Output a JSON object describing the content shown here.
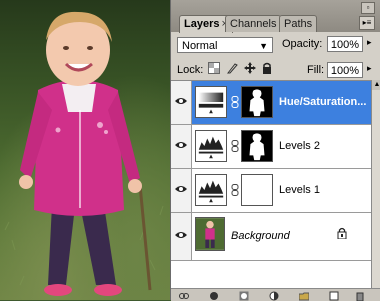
{
  "tabs": [
    {
      "label": "Layers",
      "close": "×"
    },
    {
      "label": "Channels"
    },
    {
      "label": "Paths"
    }
  ],
  "panel_menu_icon": "▸≡",
  "blend_mode": "Normal",
  "opacity": {
    "label": "Opacity:",
    "value": "100%"
  },
  "lock": {
    "label": "Lock:"
  },
  "fill": {
    "label": "Fill:",
    "value": "100%"
  },
  "layers": [
    {
      "name": "Hue/Saturation...",
      "selected": true
    },
    {
      "name": "Levels 2"
    },
    {
      "name": "Levels 1"
    },
    {
      "name": "Background",
      "locked": true
    }
  ],
  "icons": [
    "eye-icon",
    "link-icon",
    "lock-icon",
    "move-icon",
    "brush-icon",
    "checker-icon"
  ],
  "colors": {
    "selection": "#3d80df",
    "panel": "#d4d0c8"
  }
}
